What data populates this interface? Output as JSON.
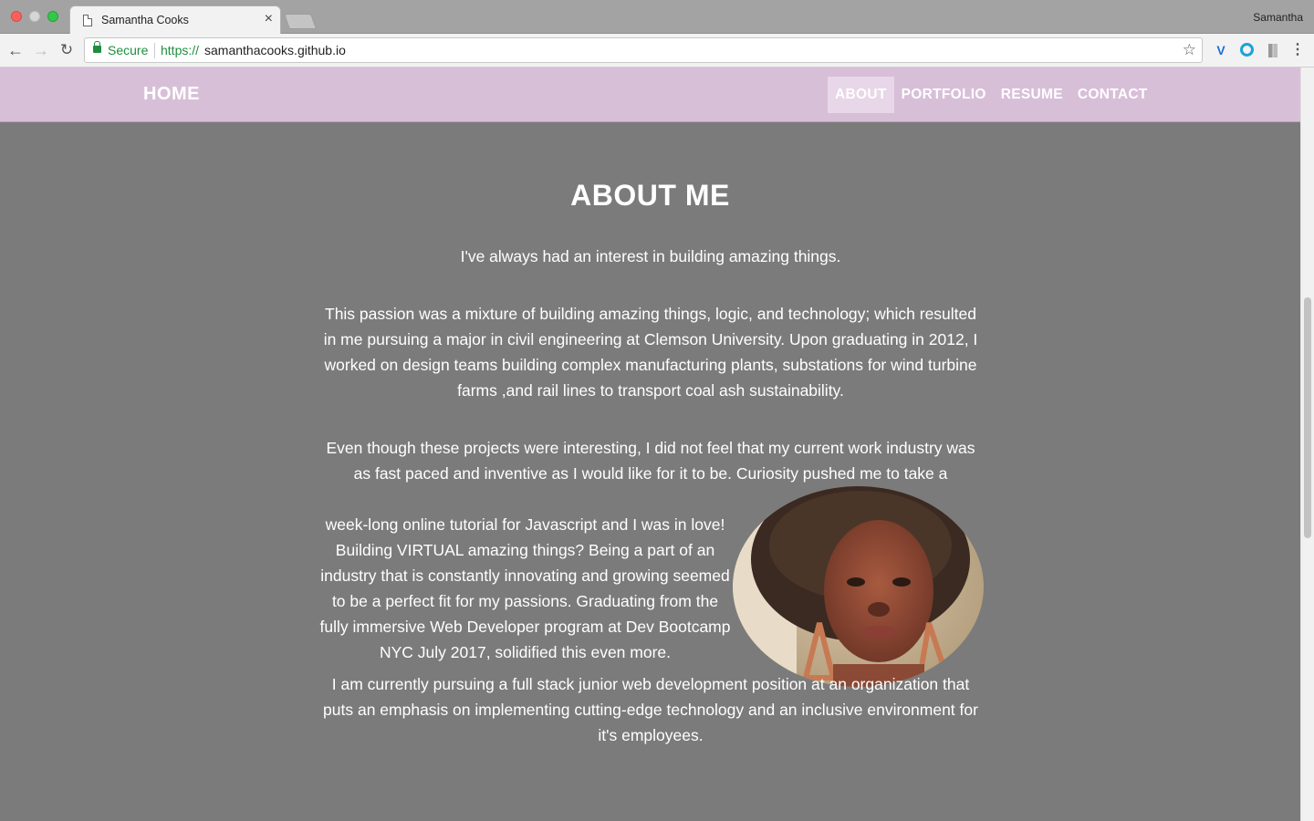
{
  "browser": {
    "tab_title": "Samantha Cooks",
    "tab_close": "×",
    "profile": "Samantha",
    "secure_label": "Secure",
    "url_scheme": "https://",
    "url_host": "samanthacooks.github.io"
  },
  "nav": {
    "brand": "HOME",
    "links": [
      {
        "label": "ABOUT",
        "active": true
      },
      {
        "label": "PORTFOLIO",
        "active": false
      },
      {
        "label": "RESUME",
        "active": false
      },
      {
        "label": "CONTACT",
        "active": false
      }
    ]
  },
  "about": {
    "title": "ABOUT ME",
    "p1": "I've always had an interest in building amazing things.",
    "p2": "This passion was a mixture of building amazing things, logic, and technology; which resulted in me pursuing a major in civil engineering at Clemson University. Upon graduating in 2012, I worked on design teams building complex manufacturing plants, substations for wind turbine farms ,and rail lines to transport coal ash sustainability.",
    "p3": "Even though these projects were interesting, I did not feel that my current work industry was as fast paced and inventive as I would like for it to be. Curiosity pushed me to take a",
    "p3b": "week-long online tutorial for Javascript and I was in love! Building VIRTUAL amazing things? Being a part of an industry that is constantly innovating and growing seemed to be a perfect fit for my passions. Graduating from the fully immersive Web Developer program at Dev Bootcamp NYC July 2017, solidified this even more.",
    "p4": "I am currently pursuing a full stack junior web development position at an organization that puts an emphasis on implementing cutting-edge technology and an inclusive environment for it's employees."
  },
  "icons": {
    "back": "arrow-left-icon",
    "forward": "arrow-right-icon",
    "reload": "reload-icon",
    "star": "star-icon",
    "menu": "more-vert-icon"
  },
  "colors": {
    "nav_bg": "#d8bfd8",
    "page_bg": "#7b7b7b",
    "secure_green": "#1e8e3e"
  }
}
